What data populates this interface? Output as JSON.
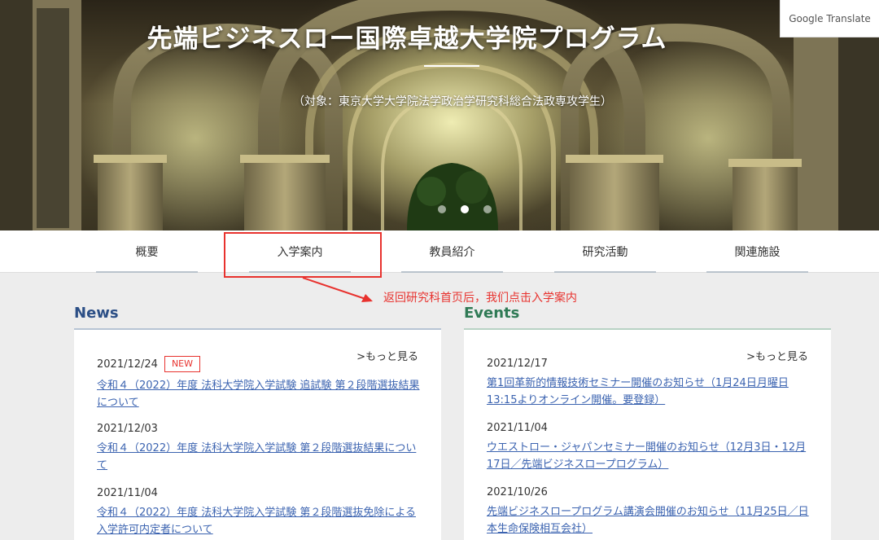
{
  "hero": {
    "title": "先端ビジネスロー国際卓越大学院プログラム",
    "subtitle": "（対象：東京大学大学院法学政治学研究科総合法政専攻学生）"
  },
  "google_translate": "Google Translate",
  "nav": [
    {
      "label": "概要"
    },
    {
      "label": "入学案内"
    },
    {
      "label": "教員紹介"
    },
    {
      "label": "研究活動"
    },
    {
      "label": "関連施設"
    }
  ],
  "annotation": "返回研究科首页后，我们点击入学案内",
  "news": {
    "title": "News",
    "more": ">もっと見る",
    "badge": "NEW",
    "items": [
      {
        "date": "2021/12/24",
        "text": "令和４（2022）年度 法科大学院入学試験 追試験 第２段階選抜結果について"
      },
      {
        "date": "2021/12/03",
        "text": "令和４（2022）年度 法科大学院入学試験 第２段階選抜結果について"
      },
      {
        "date": "2021/11/04",
        "text": "令和４（2022）年度 法科大学院入学試験 第２段階選抜免除による入学許可内定者について"
      }
    ]
  },
  "events": {
    "title": "Events",
    "more": ">もっと見る",
    "items": [
      {
        "date": "2021/12/17",
        "text": "第1回革新的情報技術セミナー開催のお知らせ（1月24日月曜日13:15よりオンライン開催。要登録）"
      },
      {
        "date": "2021/11/04",
        "text": "ウエストロー・ジャパンセミナー開催のお知らせ（12月3日・12月17日／先端ビジネスロープログラム）"
      },
      {
        "date": "2021/10/26",
        "text": "先端ビジネスロープログラム講演会開催のお知らせ（11月25日／日本生命保険相互会社）"
      }
    ]
  },
  "colors": {
    "news_accent": "#2c4f86",
    "events_accent": "#2f7a55",
    "link": "#3b63b0",
    "annotation": "#e8322e"
  }
}
